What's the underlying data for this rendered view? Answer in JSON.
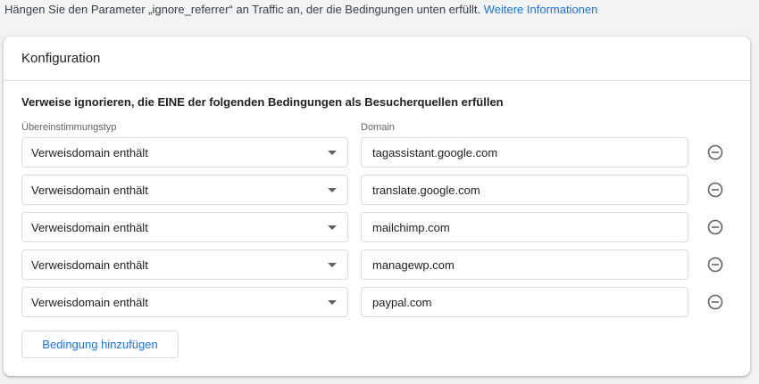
{
  "intro": {
    "text": "Hängen Sie den Parameter „ignore_referrer“ an Traffic an, der die Bedingungen unten erfüllt.",
    "link": "Weitere Informationen"
  },
  "card": {
    "title": "Konfiguration",
    "heading": "Verweise ignorieren, die EINE der folgenden Bedingungen als Besucherquellen erfüllen",
    "columns": {
      "match_type": "Übereinstimmungstyp",
      "domain": "Domain"
    },
    "conditions": [
      {
        "match_type": "Verweisdomain enthält",
        "domain": "tagassistant.google.com"
      },
      {
        "match_type": "Verweisdomain enthält",
        "domain": "translate.google.com"
      },
      {
        "match_type": "Verweisdomain enthält",
        "domain": "mailchimp.com"
      },
      {
        "match_type": "Verweisdomain enthält",
        "domain": "managewp.com"
      },
      {
        "match_type": "Verweisdomain enthält",
        "domain": "paypal.com"
      }
    ],
    "add_button": "Bedingung hinzufügen",
    "remove_icon": "remove-circle-outline-icon",
    "dropdown_icon": "dropdown-caret-icon"
  }
}
